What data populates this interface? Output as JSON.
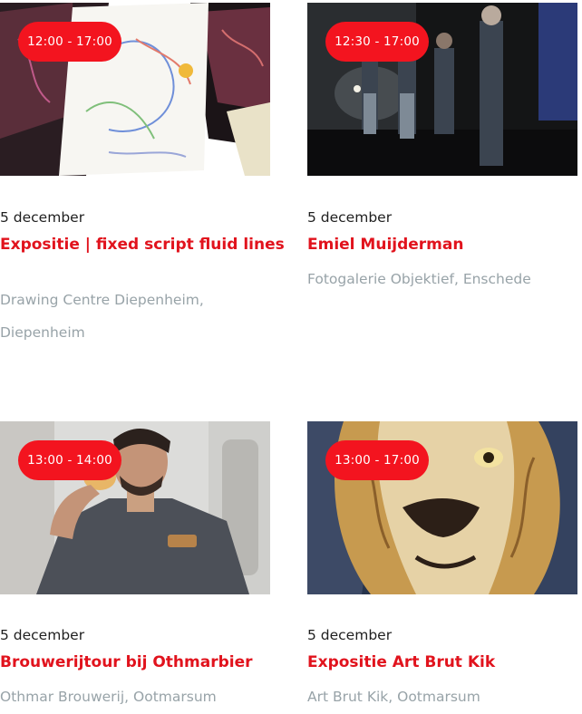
{
  "events": [
    {
      "time": "12:00 - 17:00",
      "date": "5 december",
      "title": "Expositie | fixed script fluid lines",
      "location_line1": "Drawing Centre Diepenheim,",
      "location_line2": "Diepenheim",
      "image": "sketch-drawings-photo"
    },
    {
      "time": "12:30 - 17:00",
      "date": "5 december",
      "title": "Emiel Muijderman",
      "location_line1": "Fotogalerie Objektief, Enschede",
      "image": "night-group-photo"
    },
    {
      "time": "13:00 - 14:00",
      "date": "5 december",
      "title": "Brouwerijtour bij Othmarbier",
      "location_line1": "Othmar Brouwerij, Ootmarsum",
      "image": "brewer-tasting-photo"
    },
    {
      "time": "13:00 - 17:00",
      "date": "5 december",
      "title": "Expositie Art Brut Kik",
      "location_line1": "Art Brut Kik, Ootmarsum",
      "image": "lion-painting-photo"
    }
  ],
  "colors": {
    "accent": "#e1131d",
    "badge": "#f3141f",
    "location": "#98a3a8"
  }
}
